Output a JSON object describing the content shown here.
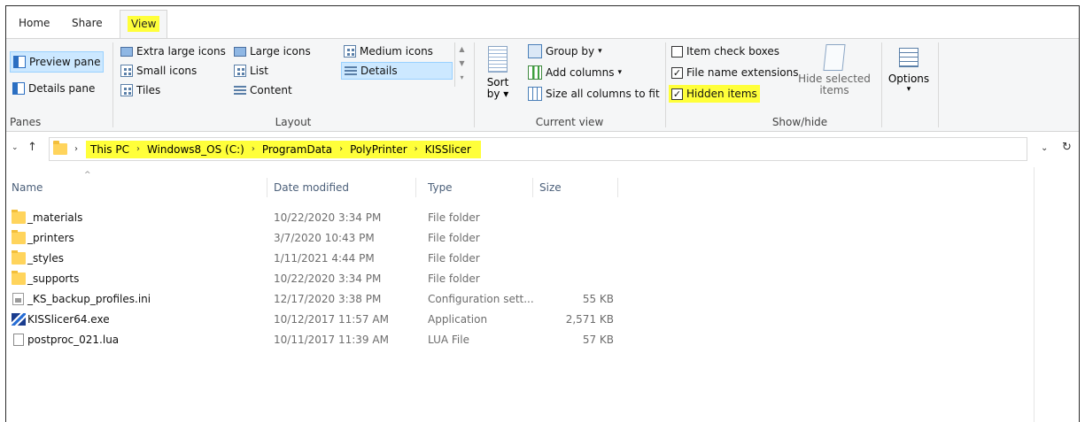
{
  "tabs": [
    "Home",
    "Share",
    "View"
  ],
  "panes": {
    "preview_pane": "Preview pane",
    "details_pane": "Details pane",
    "label": "Panes"
  },
  "layout": {
    "extra_large_icons": "Extra large icons",
    "large_icons": "Large icons",
    "medium_icons": "Medium icons",
    "small_icons": "Small icons",
    "list": "List",
    "details": "Details",
    "tiles": "Tiles",
    "content": "Content",
    "label": "Layout",
    "selected": "Details"
  },
  "current_view": {
    "sort_by": "Sort",
    "sort_by_2": "by",
    "group_by": "Group by",
    "add_columns": "Add columns",
    "size_all_columns": "Size all columns to fit",
    "label": "Current view"
  },
  "show_hide": {
    "item_check_boxes": "Item check boxes",
    "file_name_extensions": "File name extensions",
    "hidden_items": "Hidden items",
    "hide_selected_1": "Hide selected",
    "hide_selected_2": "items",
    "label": "Show/hide",
    "checks": {
      "item_check_boxes": false,
      "file_name_extensions": true,
      "hidden_items": true
    }
  },
  "options": {
    "label": "Options"
  },
  "address": {
    "crumbs": [
      "This PC",
      "Windows8_OS (C:)",
      "ProgramData",
      "PolyPrinter",
      "KISSlicer"
    ]
  },
  "columns": {
    "name": "Name",
    "date": "Date modified",
    "type": "Type",
    "size": "Size"
  },
  "files": [
    {
      "name": "_materials",
      "date": "10/22/2020 3:34 PM",
      "type": "File folder",
      "size": "",
      "icon": "folder-icon"
    },
    {
      "name": "_printers",
      "date": "3/7/2020 10:43 PM",
      "type": "File folder",
      "size": "",
      "icon": "folder-icon"
    },
    {
      "name": "_styles",
      "date": "1/11/2021 4:44 PM",
      "type": "File folder",
      "size": "",
      "icon": "folder-icon"
    },
    {
      "name": "_supports",
      "date": "10/22/2020 3:34 PM",
      "type": "File folder",
      "size": "",
      "icon": "folder-icon"
    },
    {
      "name": "_KS_backup_profiles.ini",
      "date": "12/17/2020 3:38 PM",
      "type": "Configuration sett...",
      "size": "55 KB",
      "icon": "config-file-icon"
    },
    {
      "name": "KISSlicer64.exe",
      "date": "10/12/2017 11:57 AM",
      "type": "Application",
      "size": "2,571 KB",
      "icon": "application-icon"
    },
    {
      "name": "postproc_021.lua",
      "date": "10/11/2017 11:39 AM",
      "type": "LUA File",
      "size": "57 KB",
      "icon": "file-icon"
    }
  ],
  "colors": {
    "highlight": "#ffff3a",
    "selection": "#cce8ff",
    "header_text": "#4c607a"
  }
}
